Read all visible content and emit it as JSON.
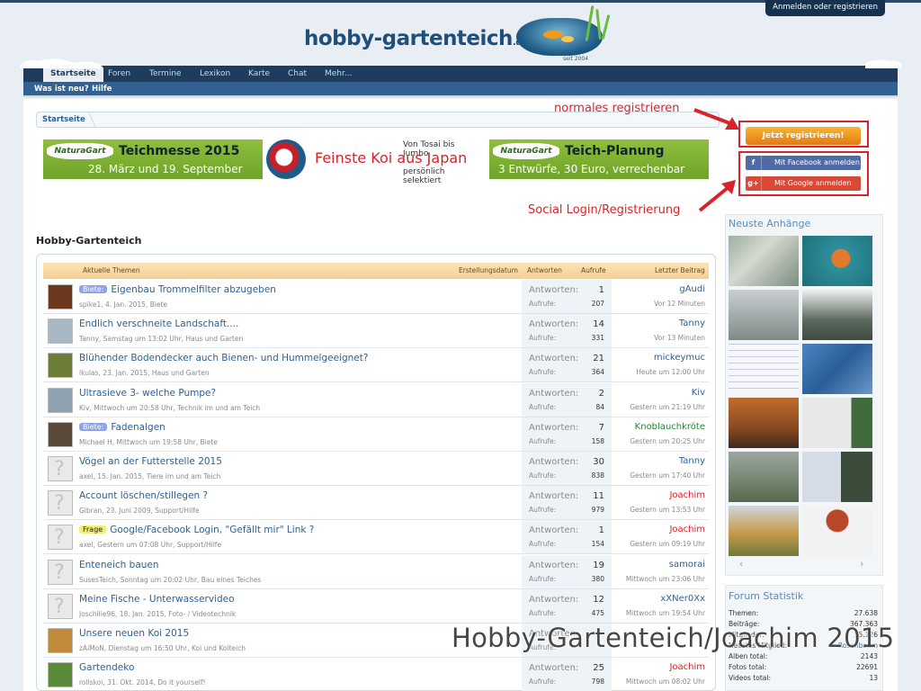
{
  "header": {
    "login_tab": "Anmelden oder registrieren",
    "logo_text": "hobby-gartenteich",
    "logo_tld": ".de",
    "logo_since": "seit 2004"
  },
  "nav": {
    "tabs": [
      "Startseite",
      "Foren",
      "Termine",
      "Lexikon",
      "Karte",
      "Chat",
      "Mehr..."
    ],
    "active": "Startseite",
    "subnav": [
      "Was ist neu?",
      "Hilfe"
    ]
  },
  "breadcrumb": "Startseite",
  "annotations": {
    "register": "normales registrieren",
    "social": "Social Login/Registrierung",
    "color": "#d8232a"
  },
  "banners": [
    {
      "logo": "NaturaGart",
      "line1": "Teichmesse 2015",
      "line2": "28. März und 19. September"
    },
    {
      "top": "Von Tosai bis Jumbo",
      "mid": "Feinste Koi aus Japan",
      "bot": "persönlich selektiert"
    },
    {
      "logo": "NaturaGart",
      "line1": "Teich-Planung",
      "line2": "3 Entwürfe, 30 Euro, verrechenbar"
    }
  ],
  "auth": {
    "register_button": "Jetzt registrieren!",
    "facebook_button": "Mit Facebook anmelden",
    "google_button": "Mit Google anmelden"
  },
  "sidebar": {
    "attachments_title": "Neuste Anhänge",
    "stats_title": "Forum Statistik",
    "stats": [
      {
        "label": "Themen:",
        "value": "27.638"
      },
      {
        "label": "Beiträge:",
        "value": "367.363"
      },
      {
        "label": "Mitglieder:",
        "value": "15.126"
      },
      {
        "label": "Neustes Mitglied:",
        "value": "Rosenbaum"
      },
      {
        "label": "Alben total:",
        "value": "2143"
      },
      {
        "label": "Fotos total:",
        "value": "22691"
      },
      {
        "label": "Videos total:",
        "value": "13"
      }
    ]
  },
  "forum": {
    "section_title": "Hobby-Gartenteich",
    "columns": {
      "topics": "Aktuelle Themen",
      "created": "Erstellungsdatum",
      "replies": "Antworten",
      "views": "Aufrufe",
      "last": "Letzter Beitrag"
    },
    "reply_label": "Antworten:",
    "view_label": "Aufrufe:",
    "threads": [
      {
        "tag": "Biete:",
        "tag_type": "biete",
        "title": "Eigenbau Trommelfilter abzugeben",
        "author": "spike1",
        "date": "4. Jan. 2015",
        "forum": "Biete",
        "replies": "1",
        "views": "207",
        "last_user": "gAudi",
        "last_time": "Vor 12 Minuten",
        "user_color": "#2f6192"
      },
      {
        "tag": "",
        "tag_type": "",
        "title": "Endlich verschneite Landschaft....",
        "author": "Tanny",
        "date": "Samstag um 13:02 Uhr",
        "forum": "Haus und Garten",
        "replies": "14",
        "views": "331",
        "last_user": "Tanny",
        "last_time": "Vor 13 Minuten",
        "user_color": "#2f6192"
      },
      {
        "tag": "",
        "tag_type": "",
        "title": "Blühender Bodendecker auch Bienen- und Hummelgeeignet?",
        "author": "lkulas",
        "date": "23. Jan. 2015",
        "forum": "Haus und Garten",
        "replies": "21",
        "views": "364",
        "last_user": "mickeymuc",
        "last_time": "Heute um 12:00 Uhr",
        "user_color": "#2f6192"
      },
      {
        "tag": "",
        "tag_type": "",
        "title": "Ultrasieve 3- welche Pumpe?",
        "author": "Kiv",
        "date": "Mittwoch um 20:58 Uhr",
        "forum": "Technik im und am Teich",
        "replies": "2",
        "views": "84",
        "last_user": "Kiv",
        "last_time": "Gestern um 21:19 Uhr",
        "user_color": "#2f6192"
      },
      {
        "tag": "Biete:",
        "tag_type": "biete",
        "title": "Fadenalgen",
        "author": "Michael H",
        "date": "Mittwoch um 19:58 Uhr",
        "forum": "Biete",
        "replies": "7",
        "views": "158",
        "last_user": "Knoblauchkröte",
        "last_time": "Gestern um 20:25 Uhr",
        "user_color": "#1f8a2e"
      },
      {
        "tag": "",
        "tag_type": "",
        "title": "Vögel an der Futterstelle 2015",
        "author": "axel",
        "date": "15. Jan. 2015",
        "forum": "Tiere im und am Teich",
        "replies": "30",
        "views": "838",
        "last_user": "Tanny",
        "last_time": "Gestern um 17:40 Uhr",
        "user_color": "#2f6192"
      },
      {
        "tag": "",
        "tag_type": "",
        "title": "Account löschen/stillegen ?",
        "author": "Gibran",
        "date": "23. Juni 2009",
        "forum": "Support/Hilfe",
        "replies": "11",
        "views": "979",
        "last_user": "Joachim",
        "last_time": "Gestern um 13:53 Uhr",
        "user_color": "#d8232a"
      },
      {
        "tag": "Frage",
        "tag_type": "frage",
        "title": "Google/Facebook Login, \"Gefällt mir\" Link ?",
        "author": "axel",
        "date": "Gestern um 07:08 Uhr",
        "forum": "Support/Hilfe",
        "replies": "1",
        "views": "154",
        "last_user": "Joachim",
        "last_time": "Gestern um 09:19 Uhr",
        "user_color": "#d8232a"
      },
      {
        "tag": "",
        "tag_type": "",
        "title": "Enteneich bauen",
        "author": "SusesTeich",
        "date": "Sonntag um 20:02 Uhr",
        "forum": "Bau eines Teiches",
        "replies": "19",
        "views": "380",
        "last_user": "samorai",
        "last_time": "Mittwoch um 23:06 Uhr",
        "user_color": "#2f6192"
      },
      {
        "tag": "",
        "tag_type": "",
        "title": "Meine Fische - Unterwasservideo",
        "author": "Joschilie96",
        "date": "18. Jan. 2015",
        "forum": "Foto- / Videotechnik",
        "replies": "12",
        "views": "475",
        "last_user": "xXNer0Xx",
        "last_time": "Mittwoch um 19:54 Uhr",
        "user_color": "#2f6192"
      },
      {
        "tag": "",
        "tag_type": "",
        "title": "Unsere neuen Koi 2015",
        "author": "zAiMoN",
        "date": "Dienstag um 16:50 Uhr",
        "forum": "Koi und Koiteich",
        "replies": "",
        "views": "",
        "last_user": "",
        "last_time": "",
        "user_color": "#2f6192"
      },
      {
        "tag": "",
        "tag_type": "",
        "title": "Gartendeko",
        "author": "rollskoi",
        "date": "31. Okt. 2014",
        "forum": "Do it yourself!",
        "replies": "25",
        "views": "798",
        "last_user": "Joachim",
        "last_time": "Mittwoch um 08:02 Uhr",
        "user_color": "#d8232a"
      }
    ]
  },
  "watermark": "Hobby-Gartenteich/Joachim 2015"
}
